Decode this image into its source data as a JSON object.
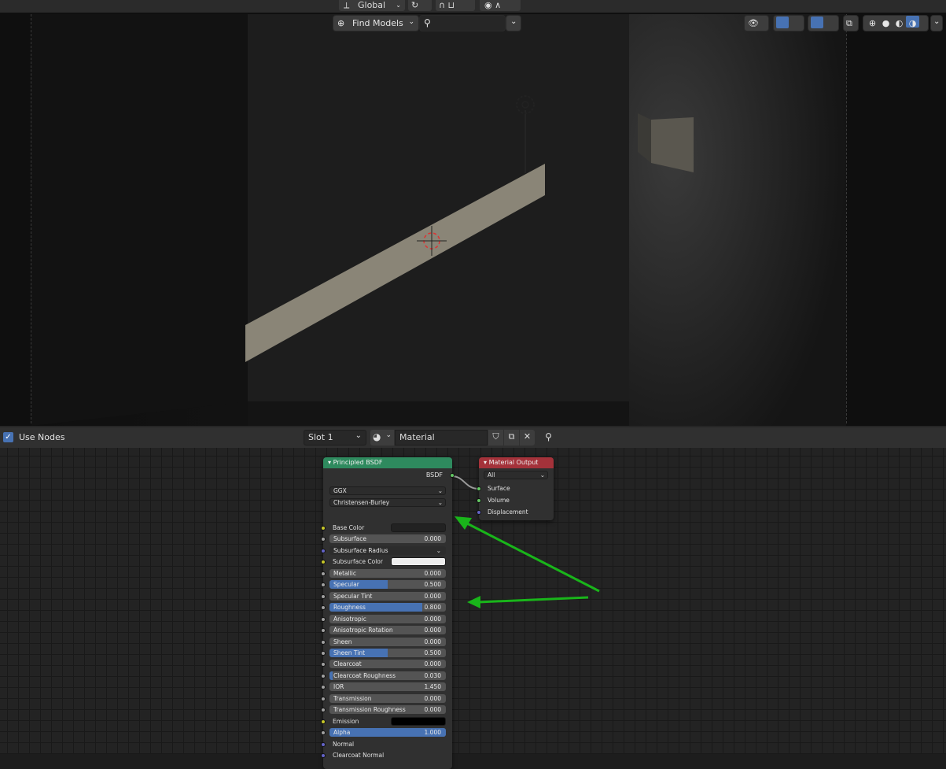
{
  "viewport_header": {
    "orientation_label": "Global",
    "asset_button_label": "Find Models",
    "search_placeholder": ""
  },
  "node_editor_header": {
    "use_nodes_label": "Use Nodes",
    "use_nodes_checked": true,
    "slot_label": "Slot 1",
    "material_name": "Material"
  },
  "principled_node": {
    "title": "Principled BSDF",
    "output_label": "BSDF",
    "distribution": "GGX",
    "subsurface_method": "Christensen-Burley",
    "inputs": [
      {
        "label": "Base Color",
        "kind": "color",
        "color": "#222222",
        "socket": "#c7c729"
      },
      {
        "label": "Subsurface",
        "kind": "value",
        "value": "0.000",
        "fraction": 0,
        "socket": "#a1a1a1"
      },
      {
        "label": "Subsurface Radius",
        "kind": "drop",
        "socket": "#6363c7"
      },
      {
        "label": "Subsurface Color",
        "kind": "color",
        "color": "#eeeeee",
        "socket": "#c7c729"
      },
      {
        "label": "Metallic",
        "kind": "value",
        "value": "0.000",
        "fraction": 0,
        "socket": "#a1a1a1"
      },
      {
        "label": "Specular",
        "kind": "value",
        "value": "0.500",
        "fraction": 0.5,
        "socket": "#a1a1a1"
      },
      {
        "label": "Specular Tint",
        "kind": "value",
        "value": "0.000",
        "fraction": 0,
        "socket": "#a1a1a1"
      },
      {
        "label": "Roughness",
        "kind": "value",
        "value": "0.800",
        "fraction": 0.8,
        "socket": "#a1a1a1"
      },
      {
        "label": "Anisotropic",
        "kind": "value",
        "value": "0.000",
        "fraction": 0,
        "socket": "#a1a1a1"
      },
      {
        "label": "Anisotropic Rotation",
        "kind": "value",
        "value": "0.000",
        "fraction": 0,
        "socket": "#a1a1a1"
      },
      {
        "label": "Sheen",
        "kind": "value",
        "value": "0.000",
        "fraction": 0,
        "socket": "#a1a1a1"
      },
      {
        "label": "Sheen Tint",
        "kind": "value",
        "value": "0.500",
        "fraction": 0.5,
        "socket": "#a1a1a1"
      },
      {
        "label": "Clearcoat",
        "kind": "value",
        "value": "0.000",
        "fraction": 0,
        "socket": "#a1a1a1"
      },
      {
        "label": "Clearcoat Roughness",
        "kind": "value",
        "value": "0.030",
        "fraction": 0.03,
        "socket": "#a1a1a1"
      },
      {
        "label": "IOR",
        "kind": "value",
        "value": "1.450",
        "fraction": 0,
        "socket": "#a1a1a1"
      },
      {
        "label": "Transmission",
        "kind": "value",
        "value": "0.000",
        "fraction": 0,
        "socket": "#a1a1a1"
      },
      {
        "label": "Transmission Roughness",
        "kind": "value",
        "value": "0.000",
        "fraction": 0,
        "socket": "#a1a1a1"
      },
      {
        "label": "Emission",
        "kind": "color",
        "color": "#000000",
        "socket": "#c7c729"
      },
      {
        "label": "Alpha",
        "kind": "value",
        "value": "1.000",
        "fraction": 1,
        "socket": "#a1a1a1"
      },
      {
        "label": "Normal",
        "kind": "plain",
        "socket": "#6363c7"
      },
      {
        "label": "Clearcoat Normal",
        "kind": "plain",
        "socket": "#6363c7"
      }
    ]
  },
  "output_node": {
    "title": "Material Output",
    "target": "All",
    "inputs": [
      {
        "label": "Surface",
        "socket": "#63c763"
      },
      {
        "label": "Volume",
        "socket": "#63c763"
      },
      {
        "label": "Displacement",
        "socket": "#6363c7"
      }
    ]
  },
  "colors": {
    "bsdf_header": "#2e8a5e",
    "output_header": "#a4323a",
    "annotation_arrow": "#19b51a",
    "slider_fill": "#4772b3"
  }
}
